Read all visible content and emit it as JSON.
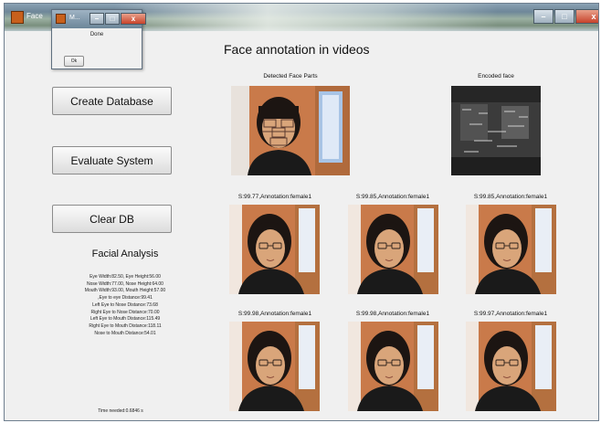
{
  "main_window": {
    "title": "Face",
    "controls": {
      "minimize": "–",
      "maximize": "□",
      "close": "x"
    }
  },
  "dialog": {
    "title": "M...",
    "message": "Done",
    "ok_label": "Ok",
    "controls": {
      "minimize": "–",
      "maximize": "□",
      "close": "x"
    }
  },
  "app": {
    "heading": "Face annotation in videos",
    "buttons": {
      "create_database": "Create Database",
      "evaluate_system": "Evaluate System",
      "clear_db": "Clear DB"
    },
    "facial_analysis": {
      "heading": "Facial Analysis",
      "lines": [
        "Eye Width:82.50, Eye Height:56.00",
        "Nose Width:77.00, Nose Height:64.00",
        "Mouth Width:93.00, Mouth Height:57.00",
        ",Eye to eye Distance:99.41",
        "Left Eye to Nose Distance:73.68",
        "Right Eye to Nose Distance:70.00",
        "Left Eye to Mouth Distance:115.49",
        "Right Eye to Mouth Distance:118.11",
        "Nose to Mouth Distance:54.01"
      ],
      "time_needed": "Time needed:0.6846 s"
    },
    "detected_face_parts_label": "Detected Face Parts",
    "encoded_face_label": "Encoded face",
    "results": [
      "S:99.77,Annotation:female1",
      "S:99.85,Annotation:female1",
      "S:99.85,Annotation:female1",
      "S:99.98,Annotation:female1",
      "S:99.98,Annotation:female1",
      "S:99.97,Annotation:female1"
    ]
  },
  "colors": {
    "skin": "#d9a57a",
    "hair": "#1c1512",
    "shirt": "#1a1a1a",
    "background_warm": "#c97a4a",
    "background_window": "#e9eef6"
  }
}
